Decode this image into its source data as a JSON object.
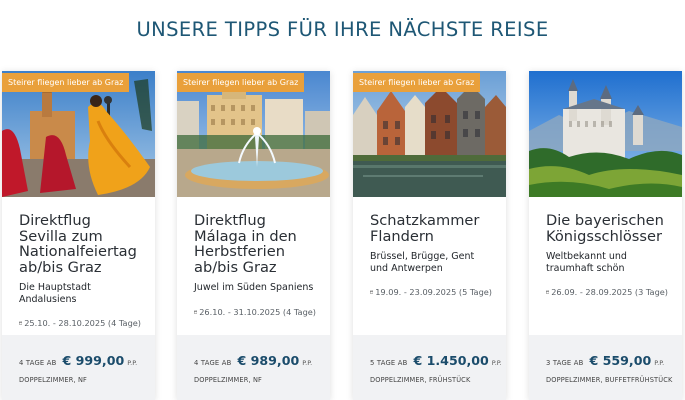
{
  "section": {
    "title": "UNSERE TIPPS FÜR IHRE NÄCHSTE REISE"
  },
  "colors": {
    "badge": "#e9a03b",
    "price": "#1b4c6b",
    "title": "#1e5775",
    "footer_bg": "#f1f2f4"
  },
  "cards": [
    {
      "badge": "Steirer fliegen lieber ab Graz",
      "image": "sevilla-flamenco-dancers",
      "title": "Direktflug Sevilla zum Nationalfeiertag ab/bis Graz",
      "subtitle": "Die Hauptstadt Andalusiens",
      "dates": "25.10. - 28.10.2025 (4 Tage)",
      "days": "4 TAGE AB",
      "price": "€ 999,00",
      "pp": "P.P.",
      "room": "DOPPELZIMMER, NF"
    },
    {
      "badge": "Steirer fliegen lieber ab Graz",
      "image": "malaga-fountain-square",
      "title": "Direktflug Málaga in den Herbstferien ab/bis Graz",
      "subtitle": "Juwel im Süden Spaniens",
      "dates": "26.10. - 31.10.2025 (4 Tage)",
      "days": "4 TAGE AB",
      "price": "€ 989,00",
      "pp": "P.P.",
      "room": "DOPPELZIMMER, NF"
    },
    {
      "badge": "Steirer fliegen lieber ab Graz",
      "image": "flanders-canal-houses",
      "title": "Schatzkammer Flandern",
      "subtitle": "Brüssel, Brügge, Gent und Antwerpen",
      "dates": "19.09. - 23.09.2025 (5 Tage)",
      "days": "5 TAGE AB",
      "price": "€ 1.450,00",
      "pp": "P.P.",
      "room": "DOPPELZIMMER, FRÜHSTÜCK"
    },
    {
      "badge": "",
      "image": "neuschwanstein-castle",
      "title": "Die bayerischen Königsschlösser",
      "subtitle": "Weltbekannt und traumhaft schön",
      "dates": "26.09. - 28.09.2025 (3 Tage)",
      "days": "3 TAGE AB",
      "price": "€ 559,00",
      "pp": "P.P.",
      "room": "DOPPELZIMMER, BUFFETFRÜHSTÜCK"
    }
  ]
}
